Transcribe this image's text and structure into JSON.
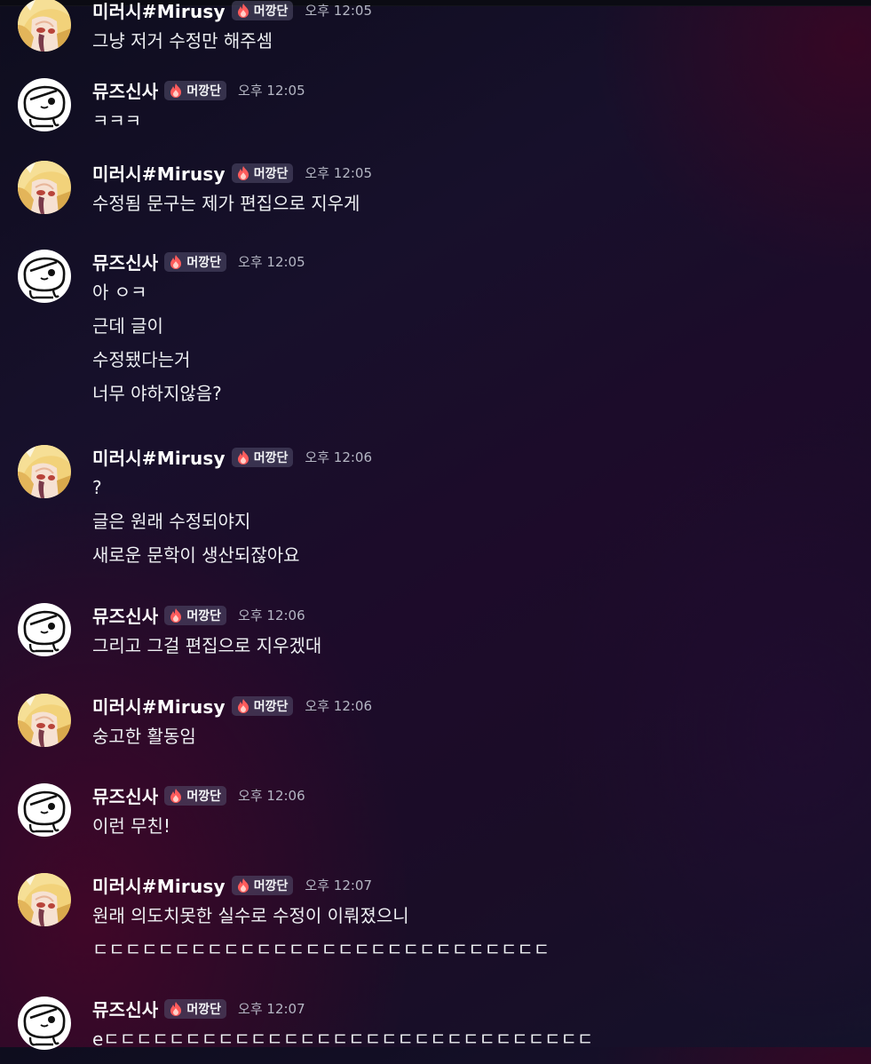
{
  "role_badge": {
    "label": "머깡단",
    "icon": "fire-icon",
    "color": "#ff5c5c"
  },
  "users": {
    "mirusy": {
      "name": "미러시#Mirusy",
      "avatar": "blonde-anime-character-avatar"
    },
    "musinsa": {
      "name": "뮤즈신사",
      "avatar": "white-cartoon-blob-avatar"
    }
  },
  "messages": [
    {
      "author": "미러시#Mirusy",
      "role": "머깡단",
      "time": "오후 12:05",
      "lines": [
        "그냥 저거 수정만 해주셈"
      ]
    },
    {
      "author": "뮤즈신사",
      "role": "머깡단",
      "time": "오후 12:05",
      "lines": [
        "ㅋㅋㅋ"
      ]
    },
    {
      "author": "미러시#Mirusy",
      "role": "머깡단",
      "time": "오후 12:05",
      "lines": [
        "수정됨 문구는 제가 편집으로 지우게"
      ]
    },
    {
      "author": "뮤즈신사",
      "role": "머깡단",
      "time": "오후 12:05",
      "lines": [
        "아 ㅇㅋ",
        "근데 글이",
        "수정됐다는거",
        "너무 야하지않음?"
      ]
    },
    {
      "author": "미러시#Mirusy",
      "role": "머깡단",
      "time": "오후 12:06",
      "lines": [
        "?",
        "글은 원래 수정되야지",
        "새로운 문학이 생산되잖아요"
      ]
    },
    {
      "author": "뮤즈신사",
      "role": "머깡단",
      "time": "오후 12:06",
      "lines": [
        "그리고 그걸 편집으로 지우겠대"
      ]
    },
    {
      "author": "미러시#Mirusy",
      "role": "머깡단",
      "time": "오후 12:06",
      "lines": [
        "숭고한 활동임"
      ]
    },
    {
      "author": "뮤즈신사",
      "role": "머깡단",
      "time": "오후 12:06",
      "lines": [
        "이런 무친!"
      ]
    },
    {
      "author": "미러시#Mirusy",
      "role": "머깡단",
      "time": "오후 12:07",
      "lines": [
        "원래 의도치못한 실수로 수정이 이뤄졌으니",
        "ㄷㄷㄷㄷㄷㄷㄷㄷㄷㄷㄷㄷㄷㄷㄷㄷㄷㄷㄷㄷㄷㄷㄷㄷㄷㄷㄷㄷ"
      ]
    },
    {
      "author": "뮤즈신사",
      "role": "머깡단",
      "time": "오후 12:07",
      "lines": [
        "eㄷㄷㄷㄷㄷㄷㄷㄷㄷㄷㄷㄷㄷㄷㄷㄷㄷㄷㄷㄷㄷㄷㄷㄷㄷㄷㄷㄷㄷㄷ"
      ]
    }
  ]
}
